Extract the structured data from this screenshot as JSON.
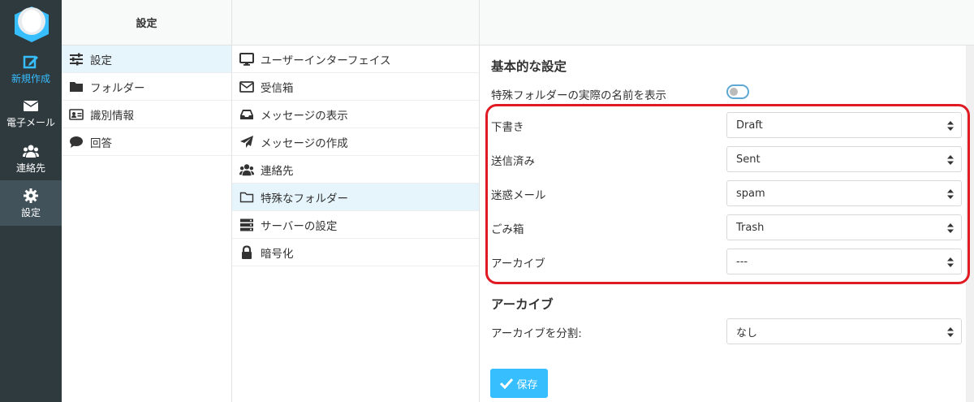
{
  "nav": {
    "compose": "新規作成",
    "mail": "電子メール",
    "contacts": "連絡先",
    "settings": "設定"
  },
  "col1": {
    "header": "設定",
    "items": [
      "設定",
      "フォルダー",
      "識別情報",
      "回答"
    ]
  },
  "col2": {
    "items": [
      "ユーザーインターフェイス",
      "受信箱",
      "メッセージの表示",
      "メッセージの作成",
      "連絡先",
      "特殊なフォルダー",
      "サーバーの設定",
      "暗号化"
    ],
    "selected_index": 5
  },
  "content": {
    "section1_title": "基本的な設定",
    "show_real_names_label": "特殊フォルダーの実際の名前を表示",
    "show_real_names_on": false,
    "folders": [
      {
        "label": "下書き",
        "value": "Draft"
      },
      {
        "label": "送信済み",
        "value": "Sent"
      },
      {
        "label": "迷惑メール",
        "value": "spam"
      },
      {
        "label": "ごみ箱",
        "value": "Trash"
      },
      {
        "label": "アーカイブ",
        "value": "---"
      }
    ],
    "section2_title": "アーカイブ",
    "archive_split_label": "アーカイブを分割:",
    "archive_split_value": "なし",
    "save_label": "保存"
  },
  "colors": {
    "accent": "#37beff",
    "nav_bg": "#2f3a3f",
    "highlight": "#e01b24"
  }
}
